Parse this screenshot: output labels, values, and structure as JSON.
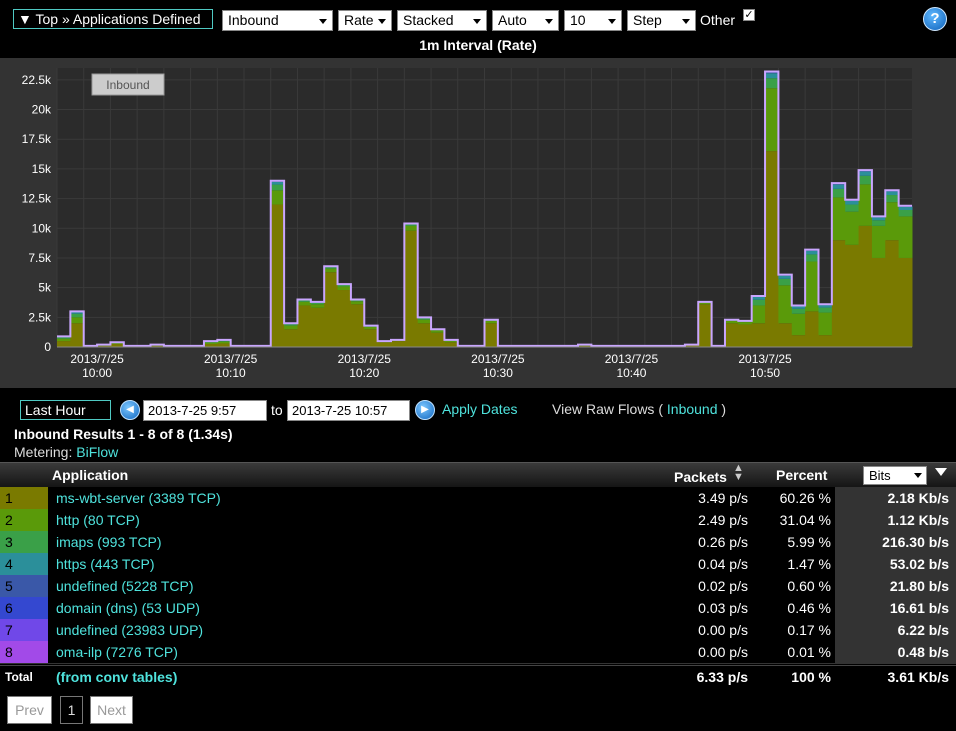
{
  "toolbar": {
    "breadcrumb": "▼ Top » Applications Defined",
    "direction": "Inbound",
    "measure": "Rate",
    "mode": "Stacked",
    "scale": "Auto",
    "count": "10",
    "style": "Step",
    "other_label": "Other",
    "other_checked": "✓",
    "help": "?"
  },
  "chart_title": "1m Interval (Rate)",
  "chart_data": {
    "type": "area",
    "legend_label": "Inbound",
    "y_ticks": [
      "0",
      "2.5k",
      "5k",
      "7.5k",
      "10k",
      "12.5k",
      "15k",
      "17.5k",
      "20k",
      "22.5k"
    ],
    "x_ticks": [
      {
        "date": "2013/7/25",
        "time": "10:00"
      },
      {
        "date": "2013/7/25",
        "time": "10:10"
      },
      {
        "date": "2013/7/25",
        "time": "10:20"
      },
      {
        "date": "2013/7/25",
        "time": "10:30"
      },
      {
        "date": "2013/7/25",
        "time": "10:40"
      },
      {
        "date": "2013/7/25",
        "time": "10:50"
      }
    ],
    "ylim": [
      0,
      23500
    ],
    "x_start_minute": 57,
    "series_colors": [
      "#7a7a00",
      "#5a9a0a",
      "#3aa048",
      "#2b8f9a",
      "#3a58a8",
      "#3448d0",
      "#7048e8",
      "#a24ae8"
    ],
    "totals": [
      900,
      3000,
      100,
      200,
      400,
      100,
      100,
      200,
      100,
      100,
      100,
      500,
      600,
      100,
      100,
      100,
      14000,
      2000,
      4000,
      3800,
      6800,
      5300,
      4000,
      1800,
      500,
      600,
      10400,
      2500,
      1500,
      600,
      100,
      100,
      2300,
      100,
      100,
      100,
      100,
      100,
      100,
      200,
      100,
      100,
      100,
      100,
      100,
      100,
      100,
      200,
      3800,
      100,
      2300,
      2200,
      4300,
      23200,
      6100,
      3500,
      8200,
      3600,
      13800,
      12400,
      14900,
      11000,
      13200,
      11900
    ],
    "first_series": [
      500,
      2000,
      50,
      100,
      250,
      50,
      50,
      100,
      50,
      50,
      50,
      250,
      300,
      50,
      50,
      50,
      12000,
      1500,
      3500,
      3300,
      6300,
      4800,
      3600,
      1500,
      400,
      500,
      9800,
      2000,
      1200,
      400,
      50,
      50,
      2000,
      50,
      50,
      50,
      50,
      50,
      50,
      100,
      50,
      50,
      50,
      50,
      50,
      50,
      50,
      150,
      3600,
      50,
      2000,
      1900,
      2000,
      16500,
      2000,
      1000,
      3000,
      1000,
      9000,
      8600,
      10200,
      7500,
      9000,
      7500
    ],
    "second_series": [
      200,
      500,
      20,
      50,
      80,
      20,
      20,
      50,
      20,
      20,
      20,
      120,
      150,
      20,
      20,
      20,
      1200,
      300,
      300,
      300,
      300,
      300,
      250,
      200,
      60,
      60,
      400,
      300,
      200,
      120,
      20,
      20,
      200,
      20,
      20,
      20,
      20,
      20,
      20,
      60,
      20,
      20,
      20,
      20,
      20,
      20,
      20,
      30,
      150,
      20,
      200,
      200,
      1500,
      5300,
      3200,
      1800,
      4200,
      1900,
      3600,
      2800,
      3500,
      2700,
      3200,
      3500
    ]
  },
  "controls": {
    "range": "Last Hour",
    "date_from": "2013-7-25 9:57",
    "to_label": "to",
    "date_to": "2013-7-25 10:57",
    "apply": "Apply Dates",
    "raw_prefix": "View Raw Flows (",
    "raw_link": "Inbound",
    "raw_suffix": ")"
  },
  "results": "Inbound Results 1 - 8 of 8 (1.34s)",
  "metering": {
    "label": "Metering:",
    "value": "BiFlow"
  },
  "table": {
    "headers": {
      "application": "Application",
      "packets": "Packets",
      "percent": "Percent",
      "bits": "Bits"
    },
    "rows": [
      {
        "num": "1",
        "app": "ms-wbt-server (3389 TCP)",
        "packets": "3.49 p/s",
        "percent": "60.26 %",
        "bits": "2.18 Kb/s",
        "color": "#7a7a00"
      },
      {
        "num": "2",
        "app": "http (80 TCP)",
        "packets": "2.49 p/s",
        "percent": "31.04 %",
        "bits": "1.12 Kb/s",
        "color": "#5a9a0a"
      },
      {
        "num": "3",
        "app": "imaps (993 TCP)",
        "packets": "0.26 p/s",
        "percent": "5.99 %",
        "bits": "216.30 b/s",
        "color": "#3aa048"
      },
      {
        "num": "4",
        "app": "https (443 TCP)",
        "packets": "0.04 p/s",
        "percent": "1.47 %",
        "bits": "53.02 b/s",
        "color": "#2b8f9a"
      },
      {
        "num": "5",
        "app": "undefined (5228 TCP)",
        "packets": "0.02 p/s",
        "percent": "0.60 %",
        "bits": "21.80 b/s",
        "color": "#3a58a8"
      },
      {
        "num": "6",
        "app": "domain (dns) (53 UDP)",
        "packets": "0.03 p/s",
        "percent": "0.46 %",
        "bits": "16.61 b/s",
        "color": "#3448d0"
      },
      {
        "num": "7",
        "app": "undefined (23983 UDP)",
        "packets": "0.00 p/s",
        "percent": "0.17 %",
        "bits": "6.22 b/s",
        "color": "#7048e8"
      },
      {
        "num": "8",
        "app": "oma-ilp (7276 TCP)",
        "packets": "0.00 p/s",
        "percent": "0.01 %",
        "bits": "0.48 b/s",
        "color": "#a24ae8"
      }
    ],
    "total": {
      "label": "Total",
      "app": "(from conv tables)",
      "packets": "6.33 p/s",
      "percent": "100 %",
      "bits": "3.61 Kb/s"
    }
  },
  "pager": {
    "prev": "Prev",
    "page": "1",
    "next": "Next"
  }
}
